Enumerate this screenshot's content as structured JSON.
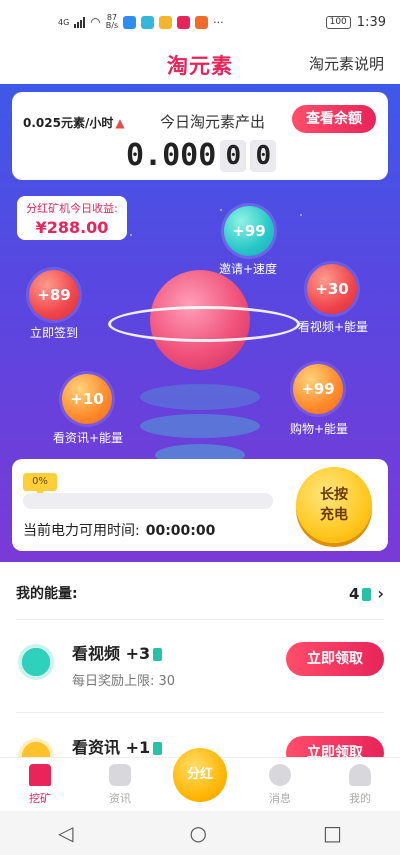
{
  "status_bar": {
    "signal_label": "4G",
    "net_speed_value": "87",
    "net_speed_unit": "B/s",
    "more": "···",
    "battery": "100",
    "time": "1:39"
  },
  "header": {
    "title": "淘元素",
    "help_link": "淘元素说明"
  },
  "output": {
    "rate": "0.025元素/小时",
    "title": "今日淘元素产出",
    "balance_button": "查看余额",
    "amount_main": "0.000",
    "amount_digits": [
      "0",
      "0"
    ]
  },
  "earnings": {
    "label": "分红矿机今日收益:",
    "value": "¥288.00"
  },
  "bubbles": [
    {
      "value": "+99",
      "caption": "邀请+速度"
    },
    {
      "value": "+89",
      "caption": "立即签到"
    },
    {
      "value": "+30",
      "caption": "看视频+能量"
    },
    {
      "value": "+10",
      "caption": "看资讯+能量"
    },
    {
      "value": "+99",
      "caption": "购物+能量"
    }
  ],
  "power": {
    "percent_label": "0%",
    "progress": 0,
    "time_label": "当前电力可用时间:",
    "time_value": "00:00:00",
    "charge_line1": "长按",
    "charge_line2": "充电"
  },
  "energy": {
    "label": "我的能量:",
    "count": "4"
  },
  "tasks": [
    {
      "title": "看视频 +3",
      "subtitle": "每日奖励上限: 30",
      "button": "立即领取"
    },
    {
      "title": "看资讯 +1",
      "subtitle": "",
      "button": "立即领取"
    }
  ],
  "tabbar": [
    {
      "label": "挖矿"
    },
    {
      "label": "资讯"
    },
    {
      "label": "分红"
    },
    {
      "label": "消息"
    },
    {
      "label": "我的"
    }
  ],
  "colors": {
    "accent": "#e8245a",
    "stage_top": "#3f58e8",
    "stage_bottom": "#7a3ad6",
    "energy": "#25c2a6",
    "gold": "#ffc820"
  }
}
